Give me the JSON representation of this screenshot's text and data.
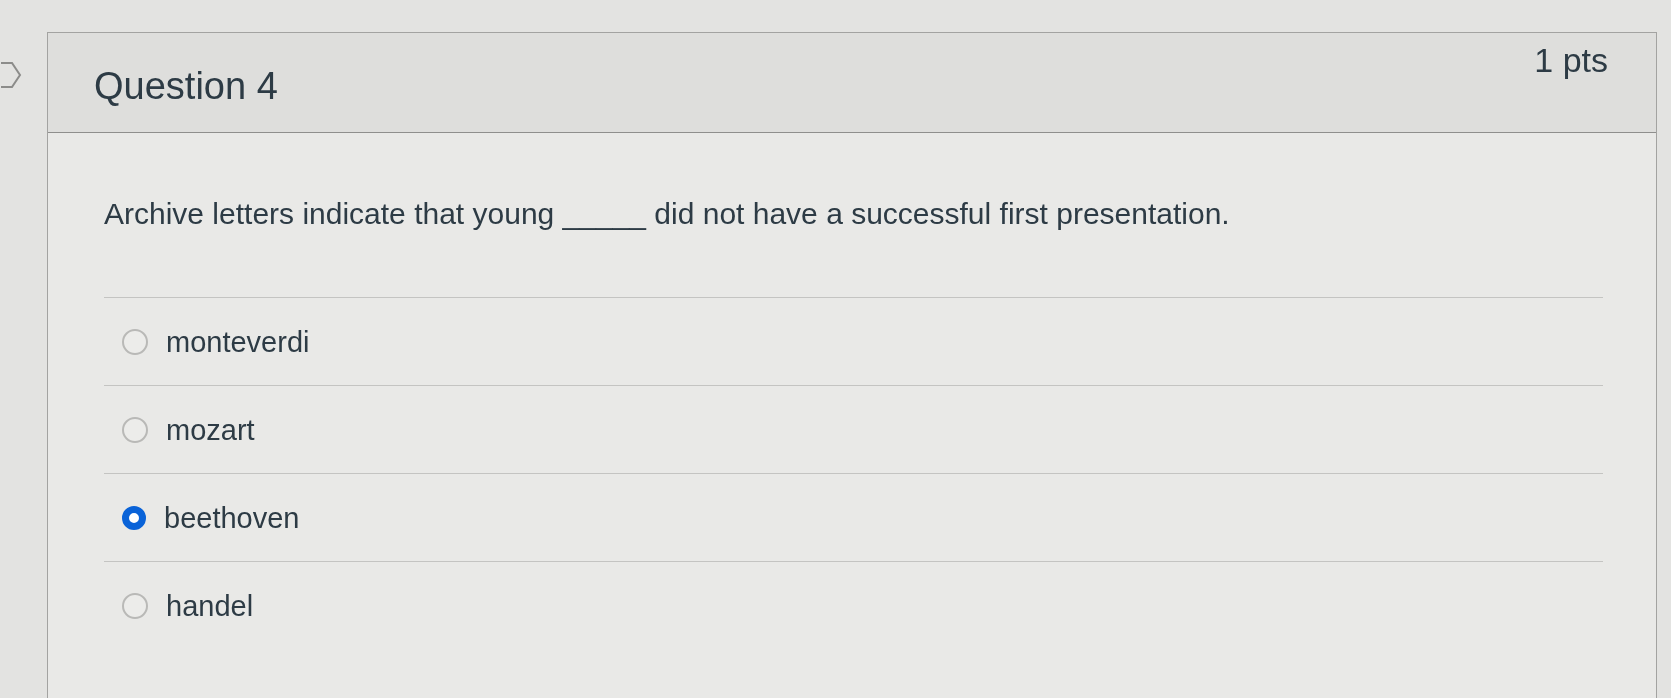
{
  "question": {
    "title": "Question 4",
    "points": "1 pts",
    "text": "Archive letters indicate that young _____ did not have a successful first presentation."
  },
  "answers": [
    {
      "label": "monteverdi",
      "selected": false
    },
    {
      "label": "mozart",
      "selected": false
    },
    {
      "label": "beethoven",
      "selected": true
    },
    {
      "label": "handel",
      "selected": false
    }
  ]
}
